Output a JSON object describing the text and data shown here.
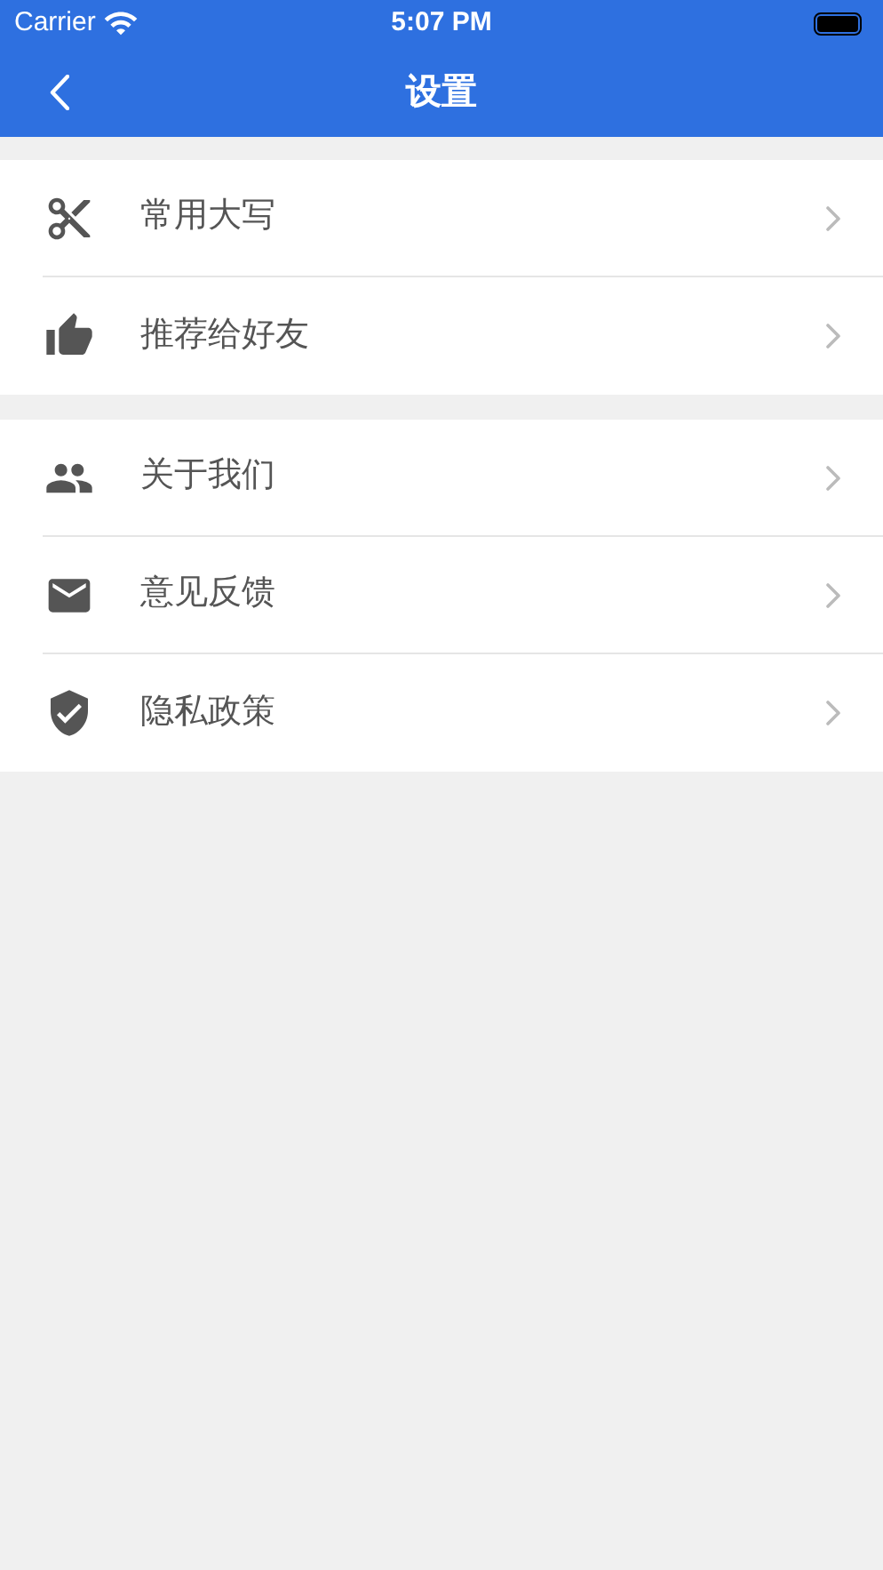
{
  "status_bar": {
    "carrier": "Carrier",
    "time": "5:07 PM"
  },
  "nav": {
    "title": "设置"
  },
  "groups": [
    {
      "items": [
        {
          "kind": "scissors",
          "label": "常用大写"
        },
        {
          "kind": "thumbs-up",
          "label": "推荐给好友"
        }
      ]
    },
    {
      "items": [
        {
          "kind": "users",
          "label": "关于我们"
        },
        {
          "kind": "mail",
          "label": "意见反馈"
        },
        {
          "kind": "shield",
          "label": "隐私政策"
        }
      ]
    }
  ]
}
